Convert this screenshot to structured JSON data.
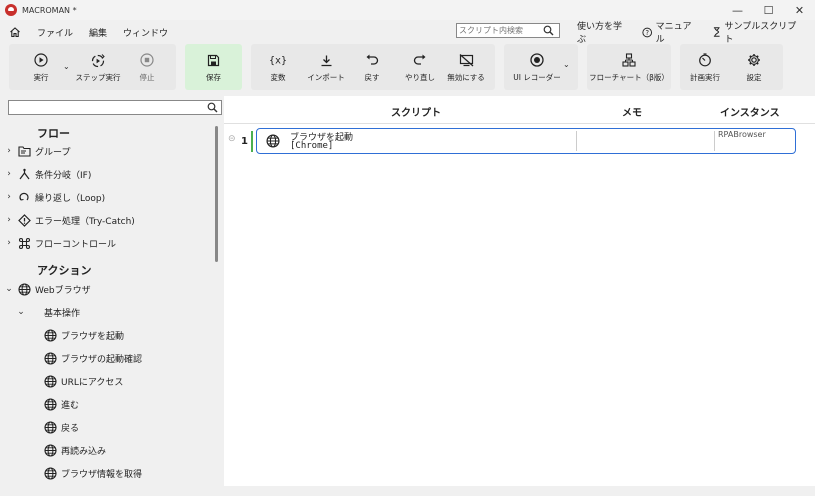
{
  "window": {
    "title": "MACROMAN *",
    "controls": [
      "—",
      "☐",
      "✕"
    ]
  },
  "menu": {
    "items": [
      "ファイル",
      "編集",
      "ウィンドウ"
    ],
    "search_placeholder": "スクリプト内検索",
    "links": [
      "使い方を学ぶ",
      "マニュアル",
      "サンプルスクリプト"
    ]
  },
  "toolbar": {
    "run": "実行",
    "step_run": "ステップ実行",
    "stop": "停止",
    "save": "保存",
    "variable": "変数",
    "import": "インポート",
    "undo": "戻す",
    "redo": "やり直し",
    "disable": "無効にする",
    "ui_recorder": "UI レコーダー",
    "flowchart": "フローチャート（β版）",
    "schedule": "計画実行",
    "settings": "設定"
  },
  "colors": {
    "save_group_bg": "#d9f2d9",
    "row_border": "#2f6fd6",
    "row_marker": "#4caf50"
  },
  "sidebar": {
    "search_placeholder": "",
    "flow_header": "フロー",
    "flow_items": [
      {
        "label": "グループ",
        "icon": "folder-icon"
      },
      {
        "label": "条件分岐（IF)",
        "icon": "branch-icon"
      },
      {
        "label": "繰り返し（Loop)",
        "icon": "loop-icon"
      },
      {
        "label": "エラー処理（Try-Catch)",
        "icon": "warning-icon"
      },
      {
        "label": "フローコントロール",
        "icon": "command-icon"
      }
    ],
    "action_header": "アクション",
    "web_browser": "Webブラウザ",
    "basic_ops": "基本操作",
    "actions": [
      "ブラウザを起動",
      "ブラウザの起動確認",
      "URLにアクセス",
      "進む",
      "戻る",
      "再読み込み",
      "ブラウザ情報を取得"
    ]
  },
  "script": {
    "headers": {
      "script": "スクリプト",
      "memo": "メモ",
      "instance": "インスタンス"
    },
    "rows": [
      {
        "number": "1",
        "gutter": "⊝",
        "title": "ブラウザを起動",
        "subtitle": "[Chrome]",
        "memo": "",
        "instance": "RPABrowser"
      }
    ]
  }
}
